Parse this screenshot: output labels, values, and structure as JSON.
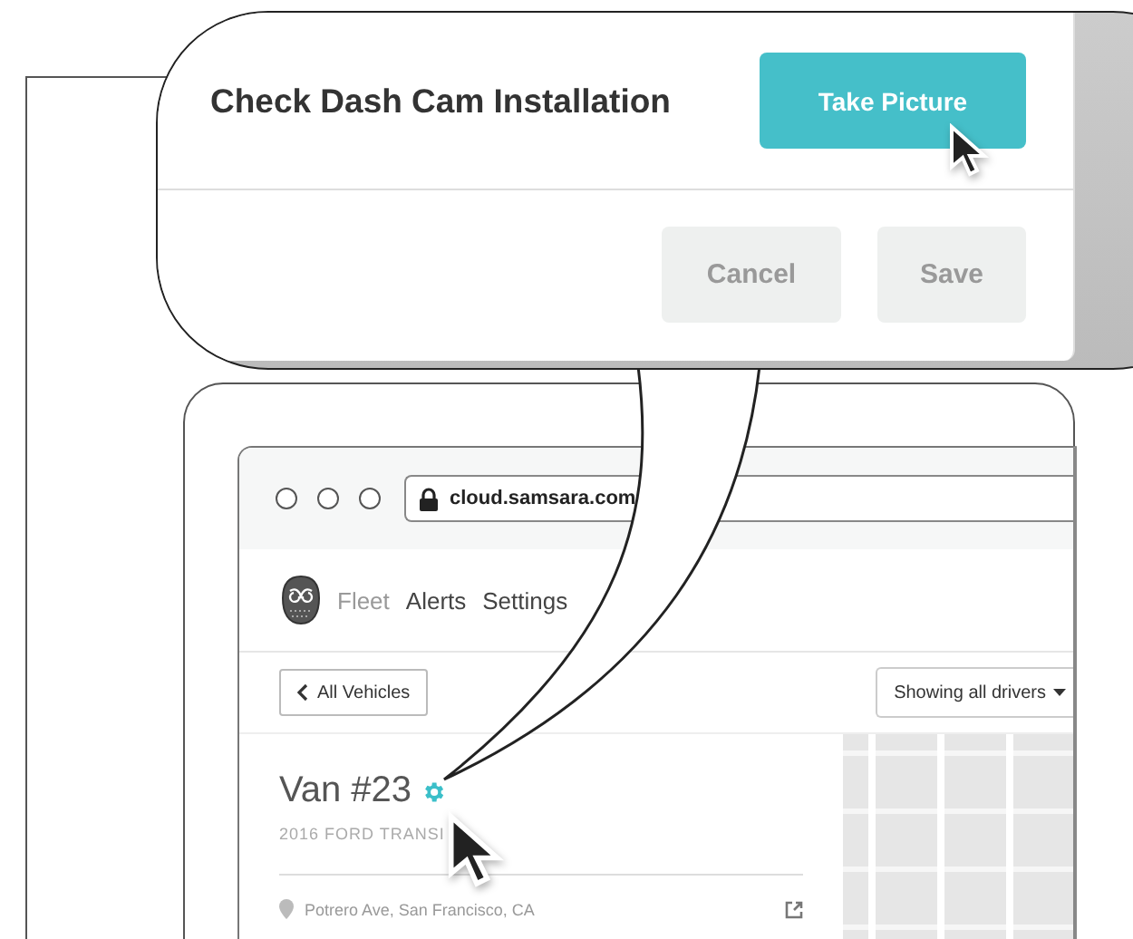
{
  "dialog": {
    "title": "Check Dash Cam Installation",
    "primary_button": "Take Picture",
    "buttons": [
      {
        "label": "Cancel",
        "disabled": true
      },
      {
        "label": "Save",
        "disabled": true
      }
    ]
  },
  "browser": {
    "url": "cloud.samsara.com"
  },
  "nav": {
    "items": [
      {
        "label": "Fleet",
        "selected": true
      },
      {
        "label": "Alerts",
        "selected": false
      },
      {
        "label": "Settings",
        "selected": false
      }
    ]
  },
  "back_button": "All Vehicles",
  "filter_dropdown": "Showing all drivers",
  "vehicle": {
    "name": "Van #23",
    "model": "2016 FORD TRANSI",
    "location": "Potrero Ave, San Francisco, CA"
  }
}
